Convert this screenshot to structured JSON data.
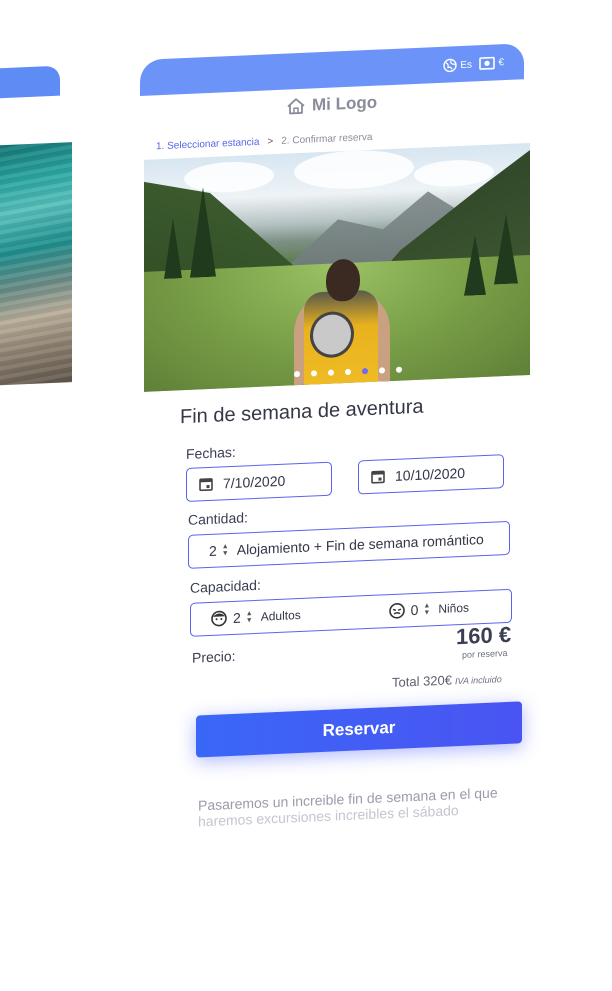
{
  "topbar": {
    "language": "Es",
    "currency": "€"
  },
  "logo": {
    "text": "Mi Logo",
    "icon": "home-icon"
  },
  "breadcrumb": {
    "step1": "1. Seleccionar estancia",
    "separator": ">",
    "step2": "2. Confirmar reserva"
  },
  "gallery": {
    "dots": 7,
    "active_dot": 5
  },
  "listing": {
    "title": "Fin de semana de aventura"
  },
  "dates": {
    "label": "Fechas:",
    "start": "7/10/2020",
    "end": "10/10/2020"
  },
  "quantity": {
    "label": "Cantidad:",
    "value": "2",
    "option": "Alojamiento + Fin de semana romántico"
  },
  "capacity": {
    "label": "Capacidad:",
    "adults_value": "2",
    "adults_label": "Adultos",
    "children_value": "0",
    "children_label": "Niños"
  },
  "price": {
    "label": "Precio:",
    "amount": "160 €",
    "per": "por reserva",
    "total": "Total 320€",
    "vat": "IVA incluido"
  },
  "cta": {
    "label": "Reservar"
  },
  "description": {
    "line1": "Pasaremos un increible fin de semana en el que",
    "line2": "haremos excursiones increibles el sábado"
  },
  "colors": {
    "topbar": "#6c93f7",
    "accent": "#5a63f0",
    "button": "#3a67f7"
  }
}
